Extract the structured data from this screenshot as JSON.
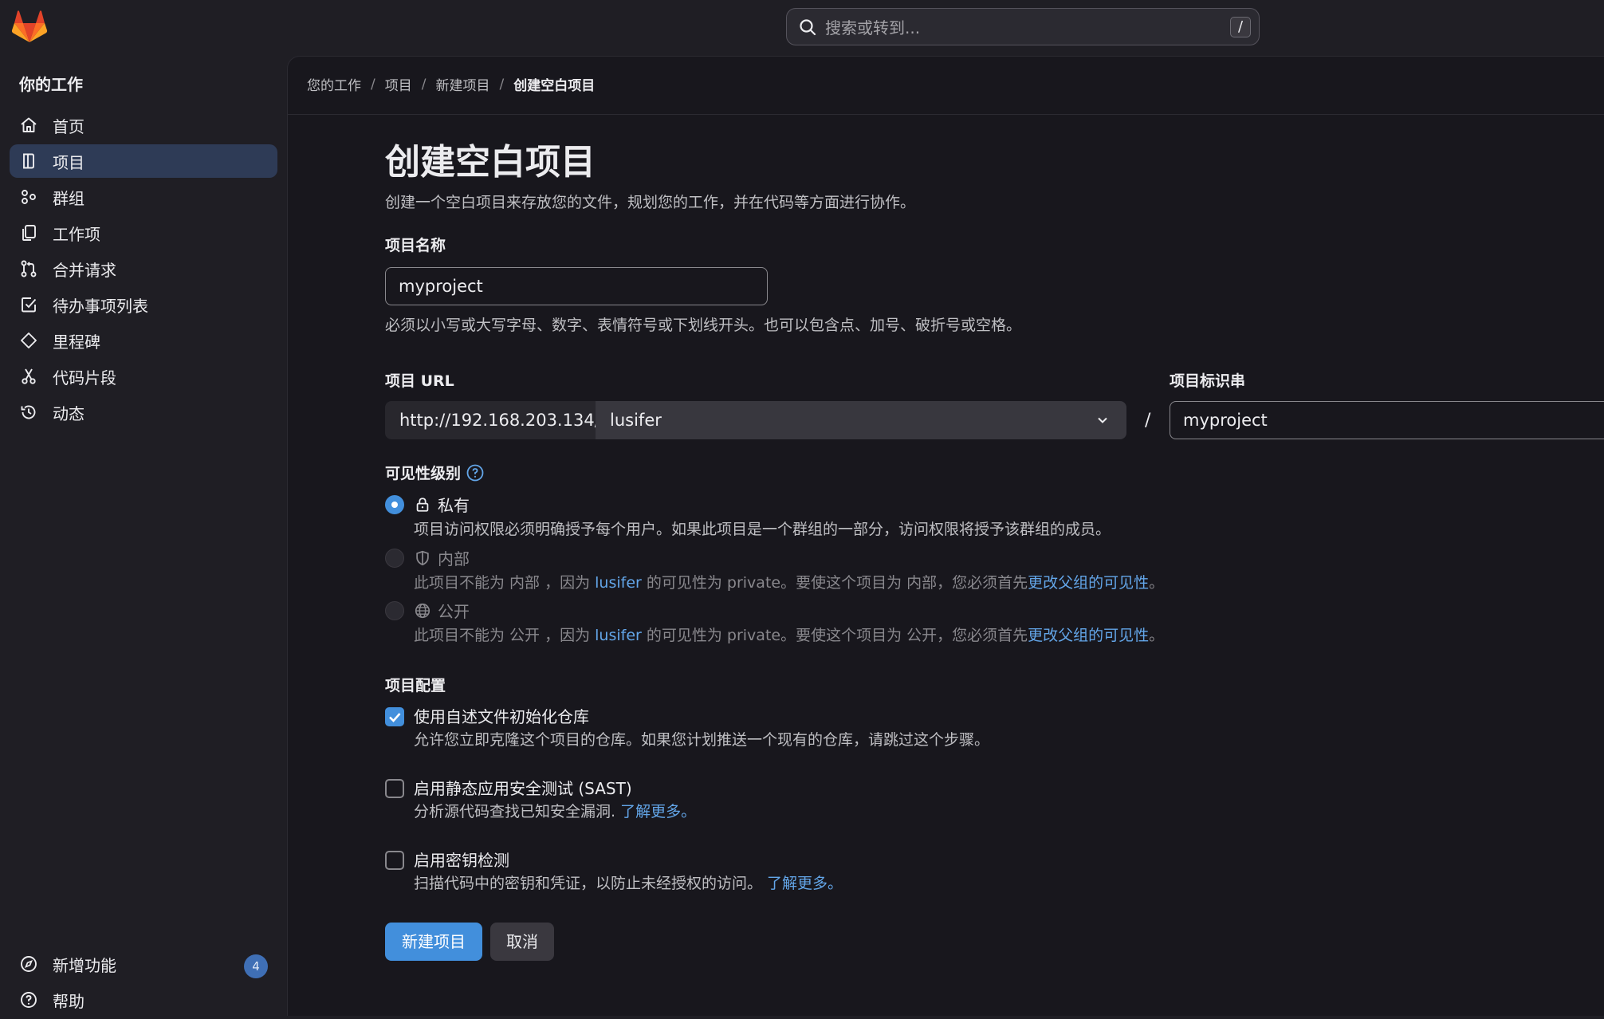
{
  "search": {
    "placeholder": "搜索或转到...",
    "shortcut": "/"
  },
  "sidebar": {
    "title": "你的工作",
    "items": [
      {
        "label": "首页",
        "icon": "home-icon"
      },
      {
        "label": "项目",
        "icon": "project-icon",
        "active": true
      },
      {
        "label": "群组",
        "icon": "group-icon"
      },
      {
        "label": "工作项",
        "icon": "work-items-icon"
      },
      {
        "label": "合并请求",
        "icon": "merge-request-icon"
      },
      {
        "label": "待办事项列表",
        "icon": "todo-icon"
      },
      {
        "label": "里程碑",
        "icon": "milestone-icon"
      },
      {
        "label": "代码片段",
        "icon": "snippet-icon"
      },
      {
        "label": "动态",
        "icon": "history-icon"
      }
    ],
    "bottom": {
      "whats_new": {
        "label": "新增功能",
        "badge": "4"
      },
      "help": {
        "label": "帮助"
      }
    }
  },
  "breadcrumb": [
    "您的工作",
    "项目",
    "新建项目",
    "创建空白项目"
  ],
  "page": {
    "title": "创建空白项目",
    "description": "创建一个空白项目来存放您的文件，规划您的工作，并在代码等方面进行协作。"
  },
  "form": {
    "name_label": "项目名称",
    "name_value": "myproject",
    "name_hint": "必须以小写或大写字母、数字、表情符号或下划线开头。也可以包含点、加号、破折号或空格。",
    "url_label": "项目 URL",
    "url_prefix": "http://192.168.203.134/",
    "namespace": "lusifer",
    "slash": "/",
    "slug_label": "项目标识串",
    "slug_value": "myproject",
    "visibility_label": "可见性级别",
    "visibility": {
      "private": {
        "label": "私有",
        "desc": "项目访问权限必须明确授予每个用户。如果此项目是一个群组的一部分，访问权限将授予该群组的成员。"
      },
      "internal": {
        "label": "内部",
        "desc_a": "此项目不能为 内部 ，因为 ",
        "group": "lusifer",
        "desc_b": " 的可见性为 private。要使这个项目为 内部，您必须首先",
        "link": "更改父组的可见性",
        "end": "。"
      },
      "public": {
        "label": "公开",
        "desc_a": "此项目不能为 公开 ，因为 ",
        "group": "lusifer",
        "desc_b": " 的可见性为 private。要使这个项目为 公开，您必须首先",
        "link": "更改父组的可见性",
        "end": "。"
      }
    },
    "config_label": "项目配置",
    "readme": {
      "label": "使用自述文件初始化仓库",
      "desc": "允许您立即克隆这个项目的仓库。如果您计划推送一个现有的仓库，请跳过这个步骤。",
      "checked": true
    },
    "sast": {
      "label": "启用静态应用安全测试 (SAST)",
      "desc": "分析源代码查找已知安全漏洞. ",
      "link": "了解更多。",
      "checked": false
    },
    "secret": {
      "label": "启用密钥检测",
      "desc": "扫描代码中的密钥和凭证，以防止未经授权的访问。 ",
      "link": "了解更多。",
      "checked": false
    },
    "submit": "新建项目",
    "cancel": "取消"
  },
  "colors": {
    "accent": "#428fdc",
    "link": "#63a6e9",
    "bg": "#18171d",
    "sidebar": "#1f1e24"
  }
}
